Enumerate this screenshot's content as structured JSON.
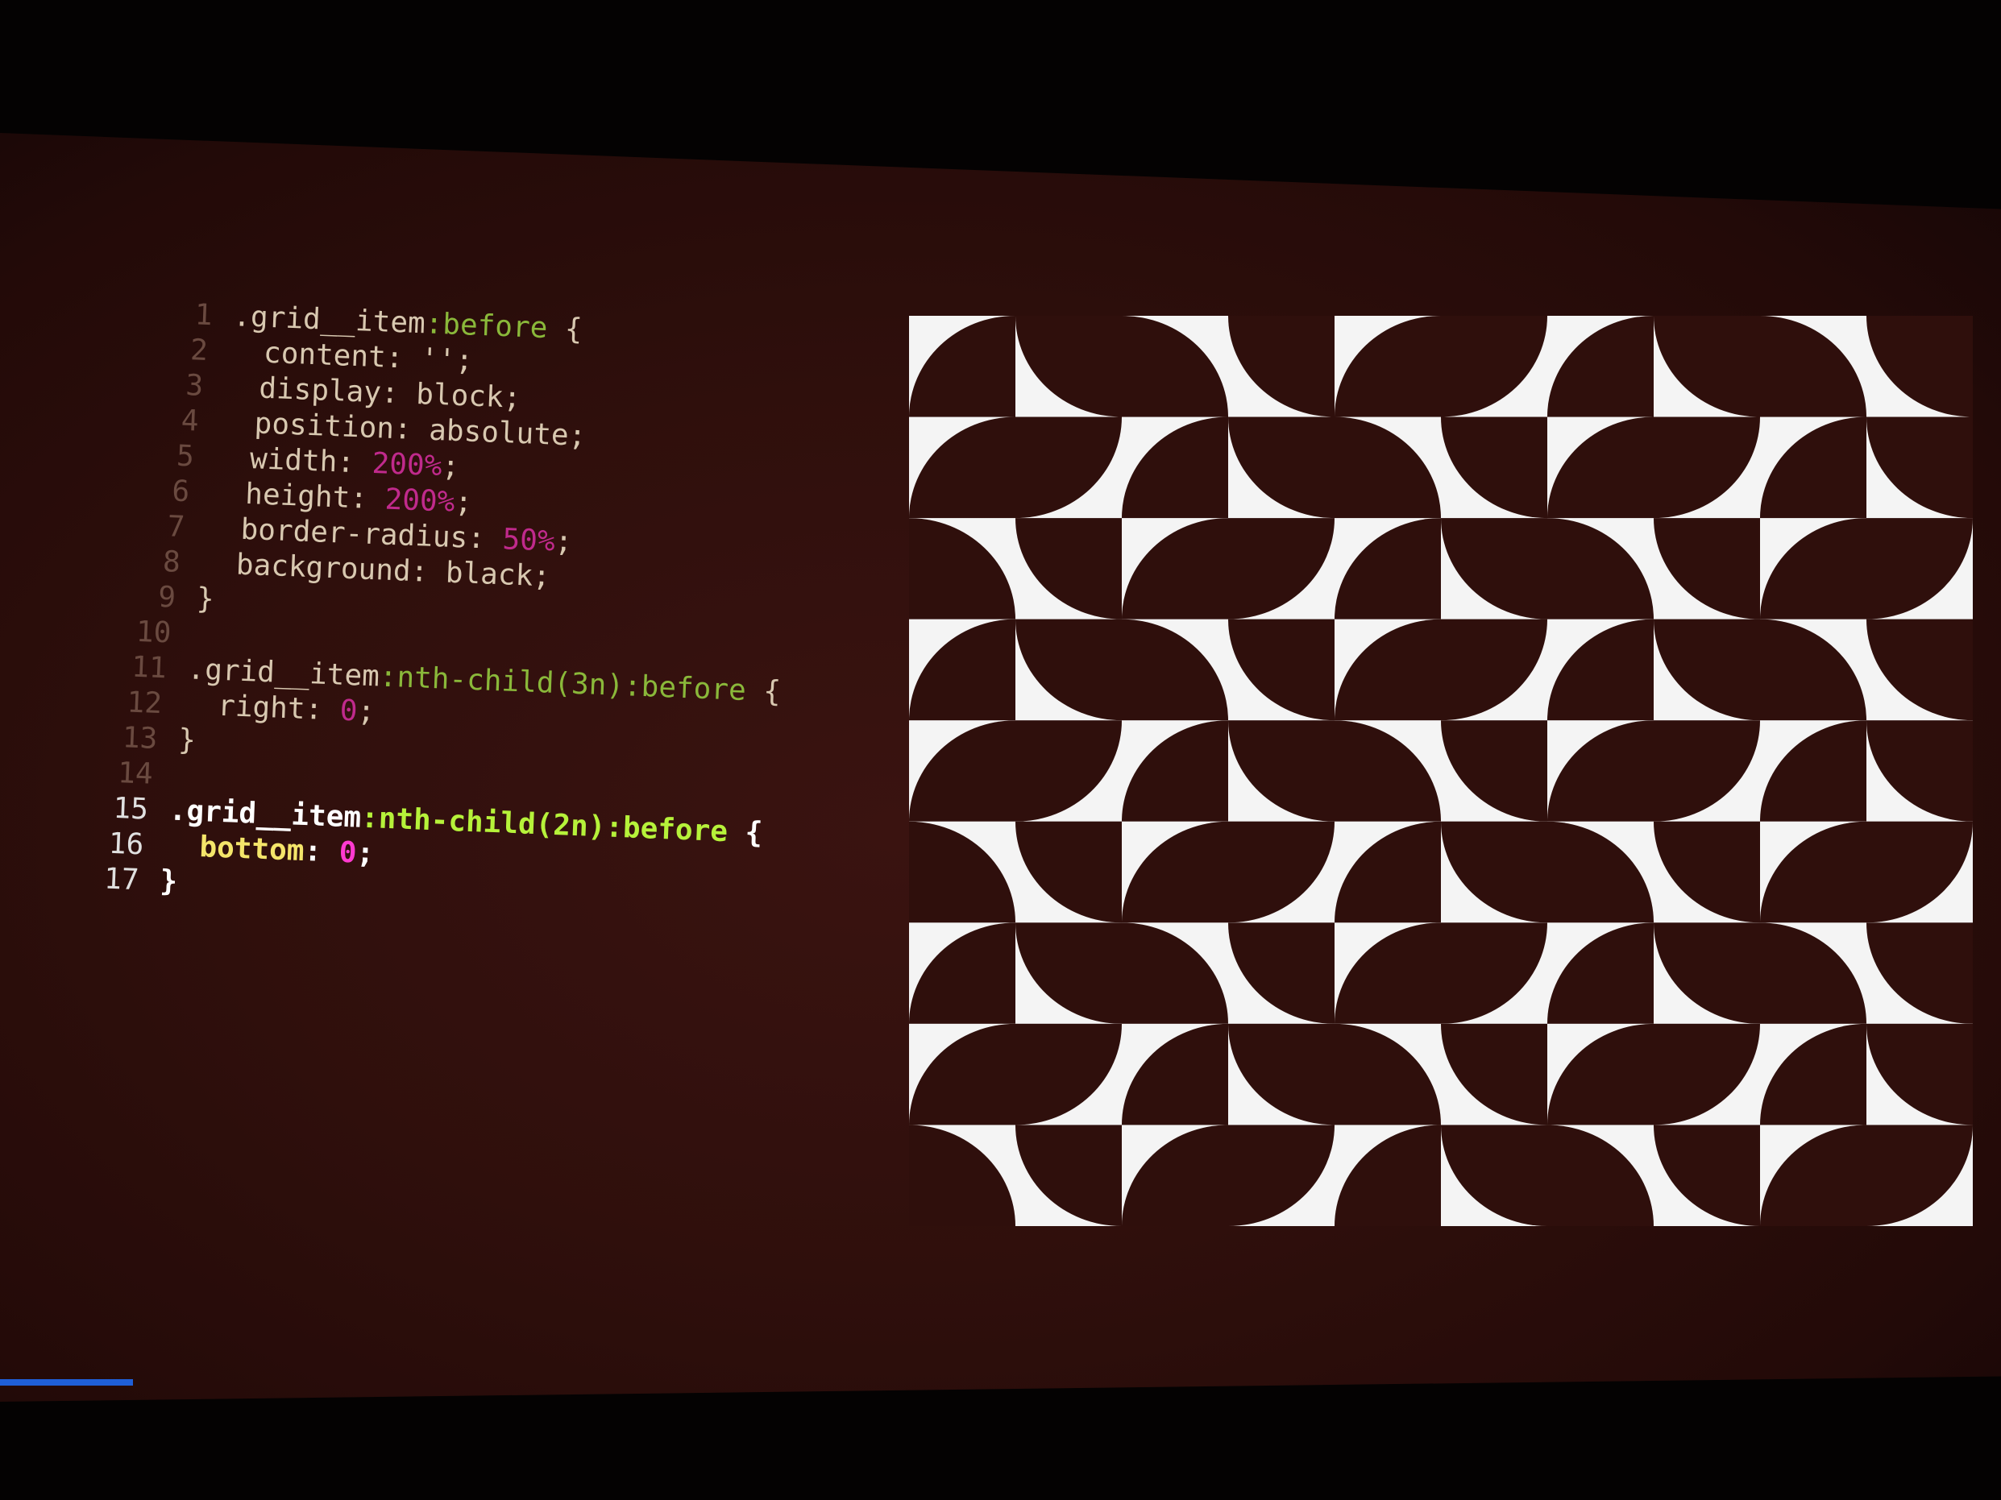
{
  "code": {
    "lines": [
      {
        "n": "1",
        "selector": ".grid__item",
        "pseudo": ":before",
        "rest": " {"
      },
      {
        "n": "2",
        "prop": "content",
        "value": "''",
        "rest": ";"
      },
      {
        "n": "3",
        "prop": "display",
        "value": "block",
        "rest": ";"
      },
      {
        "n": "4",
        "prop": "position",
        "value": "absolute",
        "rest": ";"
      },
      {
        "n": "5",
        "prop": "width",
        "number": "200%",
        "rest": ";"
      },
      {
        "n": "6",
        "prop": "height",
        "number": "200%",
        "rest": ";"
      },
      {
        "n": "7",
        "prop": "border-radius",
        "number": "50%",
        "rest": ";"
      },
      {
        "n": "8",
        "prop": "background",
        "value": "black",
        "rest": ";"
      },
      {
        "n": "9",
        "brace": "}"
      },
      {
        "n": "10"
      },
      {
        "n": "11",
        "selector": ".grid__item",
        "pseudo": ":nth-child(3n):before",
        "rest": " {"
      },
      {
        "n": "12",
        "prop": "right",
        "number": "0",
        "rest": ";"
      },
      {
        "n": "13",
        "brace": "}"
      },
      {
        "n": "14"
      },
      {
        "n": "15",
        "selector": ".grid__item",
        "pseudo": ":nth-child(2n):before",
        "rest": " {"
      },
      {
        "n": "16",
        "prop": "bottom",
        "number": "0",
        "rest": ";"
      },
      {
        "n": "17",
        "brace": "}"
      }
    ]
  },
  "pattern": {
    "background": "#f4f4f4",
    "ink": "#2f0f0c",
    "rule": "nth-child(3n) right:0; nth-child(2n) bottom:0"
  },
  "colors": {
    "progress": "#1f5fd8"
  }
}
